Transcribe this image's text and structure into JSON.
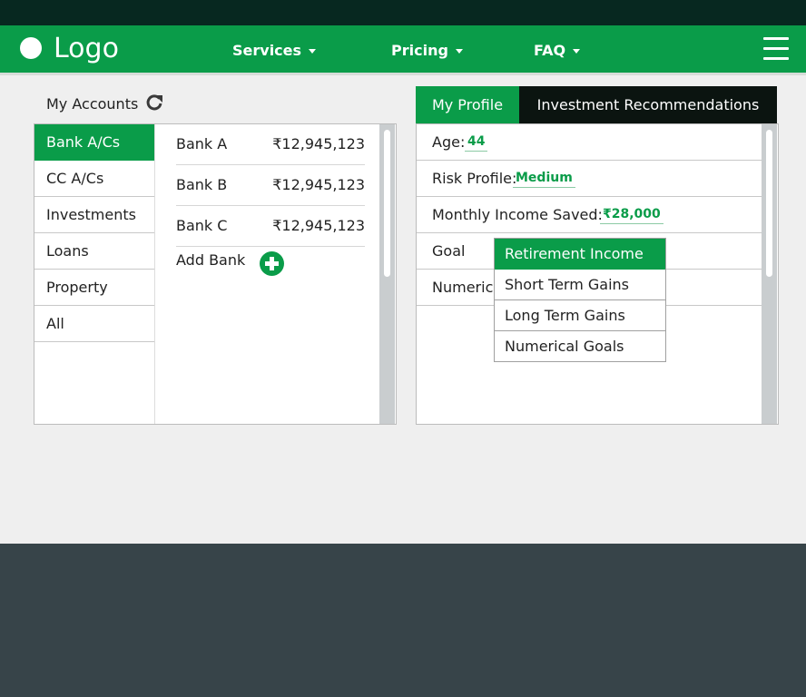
{
  "nav": {
    "logo": "Logo",
    "items": [
      {
        "label": "Services"
      },
      {
        "label": "Pricing"
      },
      {
        "label": "FAQ"
      }
    ]
  },
  "accounts": {
    "title": "My Accounts",
    "categories": [
      "Bank A/Cs",
      "CC A/Cs",
      "Investments",
      "Loans",
      "Property",
      "All"
    ],
    "selected_category": "Bank A/Cs",
    "banks": [
      {
        "name": "Bank A",
        "amount": "₹12,945,123"
      },
      {
        "name": "Bank B",
        "amount": "₹12,945,123"
      },
      {
        "name": "Bank C",
        "amount": "₹12,945,123"
      }
    ],
    "add_bank": "Add Bank"
  },
  "profile": {
    "tabs": [
      "My Profile",
      "Investment Recommendations"
    ],
    "active_tab": "My Profile",
    "age_label": "Age:",
    "age_value": "44",
    "risk_label": "Risk Profile:",
    "risk_value": "Medium",
    "income_label": "Monthly Income Saved:",
    "income_value": "₹28,000",
    "goal_label": "Goal",
    "numerical_label": "Numerica",
    "goal_options": [
      "Retirement Income",
      "Short Term Gains",
      "Long Term Gains",
      "Numerical Goals"
    ],
    "goal_selected": "Retirement Income"
  },
  "colors": {
    "brand_green": "#0a9c49",
    "top_strip": "#072820",
    "footer": "#374449"
  }
}
